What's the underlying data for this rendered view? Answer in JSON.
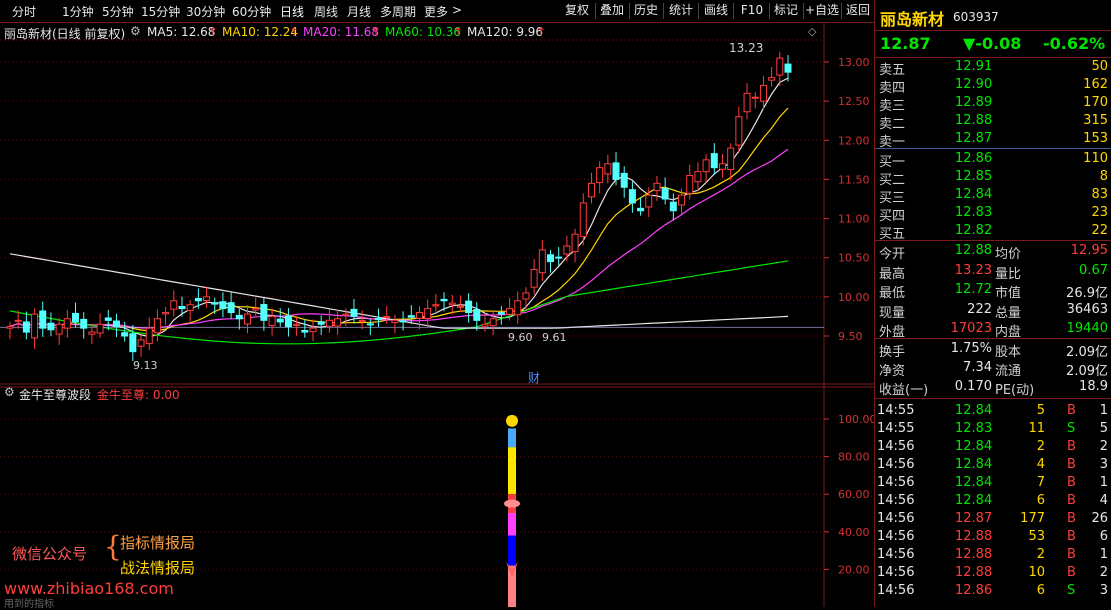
{
  "toolbar": {
    "periods": [
      "分时",
      "1分钟",
      "5分钟",
      "15分钟",
      "30分钟",
      "60分钟",
      "日线",
      "周线",
      "月线",
      "多周期",
      "更多"
    ],
    "more_arrow": ">",
    "actions": [
      "复权",
      "叠加",
      "历史",
      "统计",
      "画线",
      "F10",
      "标记",
      "+自选",
      "返回"
    ]
  },
  "main_chart": {
    "stock_title": "丽岛新材(日线 前复权)",
    "ma": [
      {
        "label": "MA5: 12.68",
        "color": "#e6e6e6"
      },
      {
        "label": "MA10: 12.24",
        "color": "#ffd700"
      },
      {
        "label": "MA20: 11.68",
        "color": "#ff40ff"
      },
      {
        "label": "MA60: 10.36",
        "color": "#00e600"
      },
      {
        "label": "MA120: 9.96",
        "color": "#e6e6e6"
      }
    ],
    "y_ticks": [
      "13.00",
      "12.50",
      "12.00",
      "11.50",
      "11.00",
      "10.50",
      "10.00",
      "9.50"
    ],
    "annotations": {
      "high": "13.23",
      "low": "9.13",
      "low2a": "9.60",
      "low2b": "9.61",
      "cai": "财"
    }
  },
  "indicator": {
    "name": "金牛至尊波段",
    "value_label": "金牛至尊: 0.00",
    "y_ticks": [
      "100.00",
      "80.00",
      "60.00",
      "40.00",
      "20.00"
    ]
  },
  "watermark": {
    "wechat": "微信公众号",
    "line1": "指标情报局",
    "line2": "战法情报局",
    "url": "www.zhibiao168.com",
    "footer": "用到的指标"
  },
  "quote": {
    "name": "丽岛新材",
    "code": "603937",
    "price": "12.87",
    "change": "▼-0.08",
    "change_pct": "-0.62%",
    "asks": [
      {
        "label": "卖五",
        "price": "12.91",
        "vol": "50"
      },
      {
        "label": "卖四",
        "price": "12.90",
        "vol": "162"
      },
      {
        "label": "卖三",
        "price": "12.89",
        "vol": "170"
      },
      {
        "label": "卖二",
        "price": "12.88",
        "vol": "315"
      },
      {
        "label": "卖一",
        "price": "12.87",
        "vol": "153"
      }
    ],
    "bids": [
      {
        "label": "买一",
        "price": "12.86",
        "vol": "110"
      },
      {
        "label": "买二",
        "price": "12.85",
        "vol": "8"
      },
      {
        "label": "买三",
        "price": "12.84",
        "vol": "83"
      },
      {
        "label": "买四",
        "price": "12.83",
        "vol": "23"
      },
      {
        "label": "买五",
        "price": "12.82",
        "vol": "22"
      }
    ],
    "stats": [
      {
        "l1": "今开",
        "v1": "12.88",
        "c1": "green",
        "l2": "均价",
        "v2": "12.95",
        "c2": "red"
      },
      {
        "l1": "最高",
        "v1": "13.23",
        "c1": "red",
        "l2": "量比",
        "v2": "0.67",
        "c2": "green"
      },
      {
        "l1": "最低",
        "v1": "12.72",
        "c1": "green",
        "l2": "市值",
        "v2": "26.9亿",
        "c2": "white"
      },
      {
        "l1": "现量",
        "v1": "222",
        "c1": "white",
        "l2": "总量",
        "v2": "36463",
        "c2": "white"
      },
      {
        "l1": "外盘",
        "v1": "17023",
        "c1": "red",
        "l2": "内盘",
        "v2": "19440",
        "c2": "green"
      }
    ],
    "stats2": [
      {
        "l1": "换手",
        "v1": "1.75%",
        "l2": "股本",
        "v2": "2.09亿"
      },
      {
        "l1": "净资",
        "v1": "7.34",
        "l2": "流通",
        "v2": "2.09亿"
      },
      {
        "l1": "收益(一)",
        "v1": "0.170",
        "l2": "PE(动)",
        "v2": "18.9"
      }
    ],
    "ticks": [
      {
        "t": "14:55",
        "p": "12.84",
        "v": "5",
        "s": "B",
        "n": "1"
      },
      {
        "t": "14:55",
        "p": "12.83",
        "v": "11",
        "s": "S",
        "n": "5"
      },
      {
        "t": "14:56",
        "p": "12.84",
        "v": "2",
        "s": "B",
        "n": "2"
      },
      {
        "t": "14:56",
        "p": "12.84",
        "v": "4",
        "s": "B",
        "n": "3"
      },
      {
        "t": "14:56",
        "p": "12.84",
        "v": "7",
        "s": "B",
        "n": "1"
      },
      {
        "t": "14:56",
        "p": "12.84",
        "v": "6",
        "s": "B",
        "n": "4"
      },
      {
        "t": "14:56",
        "p": "12.87",
        "v": "177",
        "s": "B",
        "n": "26"
      },
      {
        "t": "14:56",
        "p": "12.88",
        "v": "53",
        "s": "B",
        "n": "6"
      },
      {
        "t": "14:56",
        "p": "12.88",
        "v": "2",
        "s": "B",
        "n": "1"
      },
      {
        "t": "14:56",
        "p": "12.88",
        "v": "10",
        "s": "B",
        "n": "2"
      },
      {
        "t": "14:56",
        "p": "12.86",
        "v": "6",
        "s": "S",
        "n": "3"
      }
    ]
  }
}
